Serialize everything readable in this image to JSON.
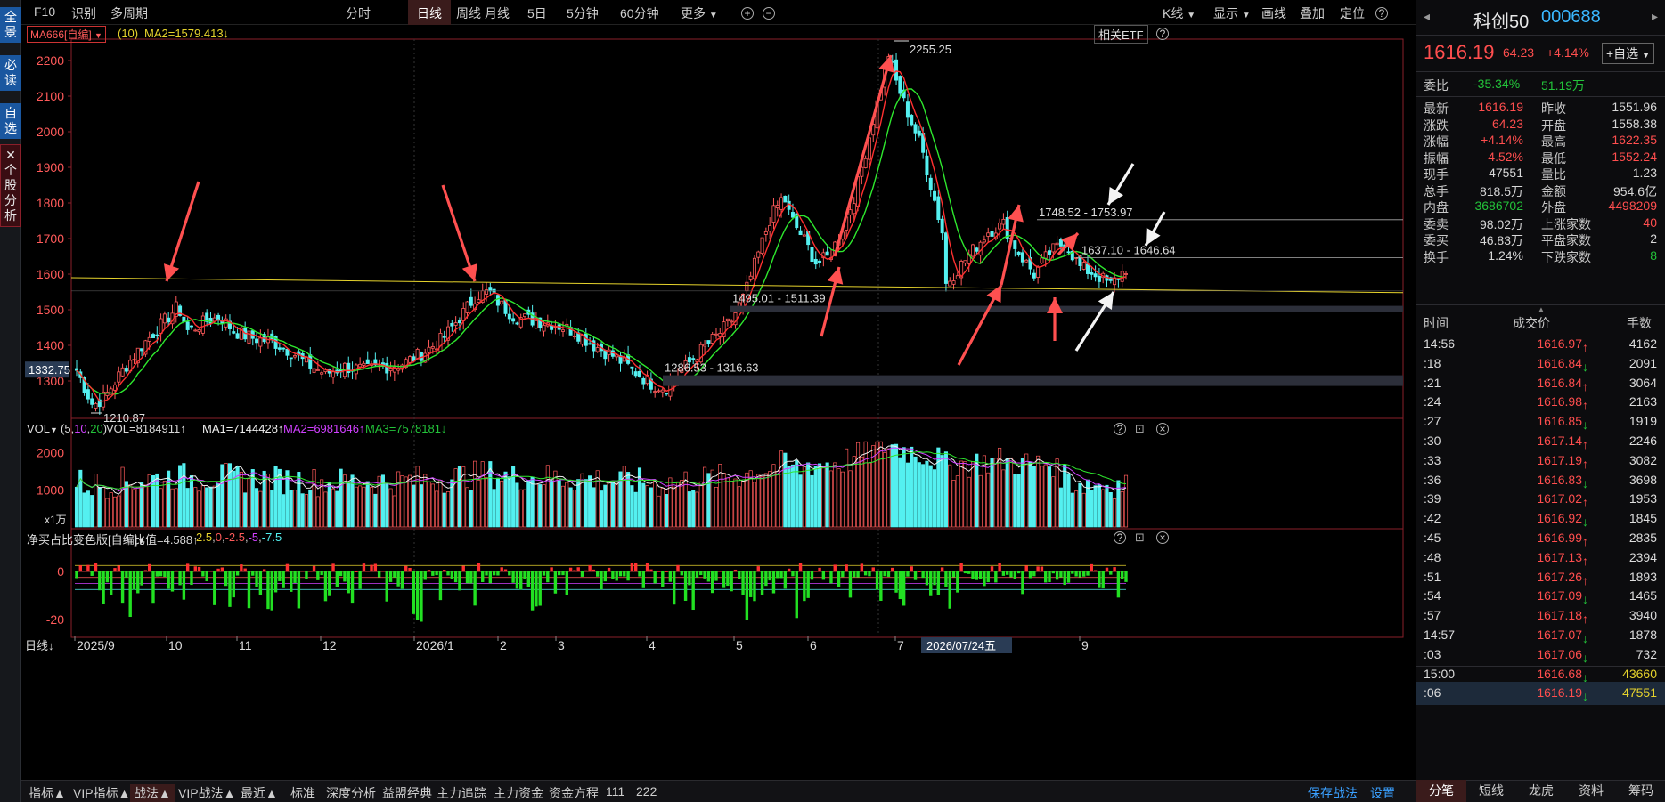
{
  "left_sidebar": {
    "items": [
      "全景",
      "必读",
      "自选"
    ],
    "stock_analysis": "✕ 个股分析"
  },
  "toolbar": {
    "items": [
      "F10",
      "识别",
      "多周期"
    ],
    "periods": [
      "分时",
      "日线",
      "周线",
      "月线",
      "5日",
      "5分钟",
      "60分钟"
    ],
    "active_period": "日线",
    "more": "更多",
    "right_items": [
      "K线",
      "显示",
      "画线",
      "叠加",
      "定位"
    ],
    "help": "?"
  },
  "indicator_header": {
    "name": "MA666[自编]",
    "param": "(10)",
    "ma2": "MA2=1579.413↓",
    "etf_button": "相关ETF"
  },
  "price_axis": [
    "2200",
    "2100",
    "2000",
    "1900",
    "1800",
    "1700",
    "1600",
    "1500",
    "1400",
    "1300"
  ],
  "annotations": {
    "high": "2255.25",
    "low": "1210.87",
    "current_price_tag": "1332.75",
    "zone1": "1748.52 - 1753.97",
    "zone2": "1637.10 - 1646.64",
    "zone3": "1495.01 - 1511.39",
    "zone4": "1286.53 - 1316.63"
  },
  "volume_panel": {
    "name": "VOL",
    "params": "(5,10,20)",
    "vol": "VOL=8184911↑",
    "ma1": "MA1=7144428↑",
    "ma2": "MA2=6981646↑",
    "ma3": "MA3=7578181↓",
    "axis": [
      "2000",
      "1000"
    ],
    "unit": "x1万"
  },
  "net_panel": {
    "name": "净买占比变色版[自编]",
    "ratio": "比值=4.588↑",
    "levels": [
      "2.5",
      "0",
      "-2.5",
      "-5",
      "-7.5"
    ],
    "axis": [
      "0",
      "-20"
    ]
  },
  "date_axis": {
    "period": "日线",
    "labels": [
      "2025/9",
      "10",
      "11",
      "12",
      "2026/1",
      "2",
      "3",
      "4",
      "5",
      "6",
      "7",
      "9"
    ],
    "cursor_date": "2026/07/24五"
  },
  "bottom_bar": {
    "left": [
      "指标",
      "VIP指标",
      "战法",
      "VIP战法",
      "最近"
    ],
    "links": [
      "标准",
      "深度分析",
      "益盟经典",
      "主力追踪",
      "主力资金",
      "资金方程",
      "111",
      "222"
    ],
    "right": [
      "保存战法",
      "设置"
    ]
  },
  "quote": {
    "name": "科创50",
    "code": "000688",
    "price": "1616.19",
    "change": "64.23",
    "change_pct": "+4.14%",
    "watch_button": "+自选",
    "weibi_label": "委比",
    "weibi": "-35.34%",
    "weicha": "51.19万",
    "rows": [
      [
        "最新",
        "1616.19",
        "昨收",
        "1551.96"
      ],
      [
        "涨跌",
        "64.23",
        "开盘",
        "1558.38"
      ],
      [
        "涨幅",
        "+4.14%",
        "最高",
        "1622.35"
      ],
      [
        "振幅",
        "4.52%",
        "最低",
        "1552.24"
      ],
      [
        "现手",
        "47551",
        "量比",
        "1.23"
      ],
      [
        "总手",
        "818.5万",
        "金额",
        "954.6亿"
      ],
      [
        "内盘",
        "3686702",
        "外盘",
        "4498209"
      ],
      [
        "委卖",
        "98.02万",
        "上涨家数",
        "40"
      ],
      [
        "委买",
        "46.83万",
        "平盘家数",
        "2"
      ],
      [
        "换手",
        "1.24%",
        "下跌家数",
        "8"
      ]
    ]
  },
  "trades": {
    "headers": [
      "时间",
      "成交价",
      "手数"
    ],
    "rows": [
      [
        "14:56",
        "1616.97↑",
        "4162"
      ],
      [
        ":18",
        "1616.84↓",
        "2091"
      ],
      [
        ":21",
        "1616.84↑",
        "3064"
      ],
      [
        ":24",
        "1616.98↑",
        "2163"
      ],
      [
        ":27",
        "1616.85↓",
        "1919"
      ],
      [
        ":30",
        "1617.14↑",
        "2246"
      ],
      [
        ":33",
        "1617.19↑",
        "3082"
      ],
      [
        ":36",
        "1616.83↓",
        "3698"
      ],
      [
        ":39",
        "1617.02↑",
        "1953"
      ],
      [
        ":42",
        "1616.92↓",
        "1845"
      ],
      [
        ":45",
        "1616.99↑",
        "2835"
      ],
      [
        ":48",
        "1617.13↑",
        "2394"
      ],
      [
        ":51",
        "1617.26↑",
        "1893"
      ],
      [
        ":54",
        "1617.09↓",
        "1465"
      ],
      [
        ":57",
        "1617.18↑",
        "3940"
      ],
      [
        "14:57",
        "1617.07↓",
        "1878"
      ],
      [
        ":03",
        "1617.06↓",
        "732"
      ],
      [
        "15:00",
        "1616.68↓",
        "43660"
      ],
      [
        ":06",
        "1616.19↓",
        "47551"
      ]
    ]
  },
  "right_tabs": [
    "分笔",
    "短线",
    "龙虎",
    "资料",
    "筹码"
  ],
  "chart_data": {
    "type": "candlestick",
    "series_key_prices": [
      {
        "label": "high",
        "value": 2255.25
      },
      {
        "label": "low",
        "value": 1210.87
      },
      {
        "label": "last",
        "value": 1616.19
      }
    ],
    "ylim": [
      1210,
      2260
    ],
    "xlabel": "",
    "ylabel": ""
  },
  "colors": {
    "up": "#ff5a5a",
    "down": "#54f0f0",
    "ma_red": "#ff3030",
    "ma_green": "#2ee82e",
    "accent": "#00bfff"
  }
}
